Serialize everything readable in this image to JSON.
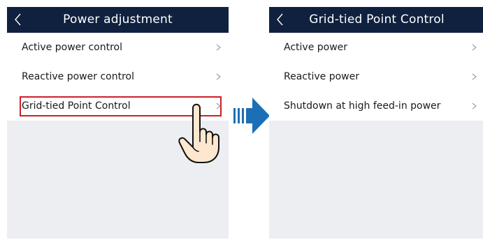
{
  "left_screen": {
    "title": "Power adjustment",
    "items": [
      {
        "label": "Active power control"
      },
      {
        "label": "Reactive power control"
      },
      {
        "label": "Grid-tied Point Control"
      }
    ]
  },
  "right_screen": {
    "title": "Grid-tied Point Control",
    "items": [
      {
        "label": "Active power"
      },
      {
        "label": "Reactive power"
      },
      {
        "label": "Shutdown at high feed-in power"
      }
    ]
  },
  "icons": {
    "back": "back-chevron-icon",
    "row": "chevron-right-icon",
    "hand": "pointing-hand-icon",
    "transition": "right-arrow-icon"
  },
  "colors": {
    "header_bg": "#10213f",
    "highlight_border": "#cf1f26",
    "arrow_blue": "#1b6fb5",
    "panel_bg": "#eceef1"
  }
}
